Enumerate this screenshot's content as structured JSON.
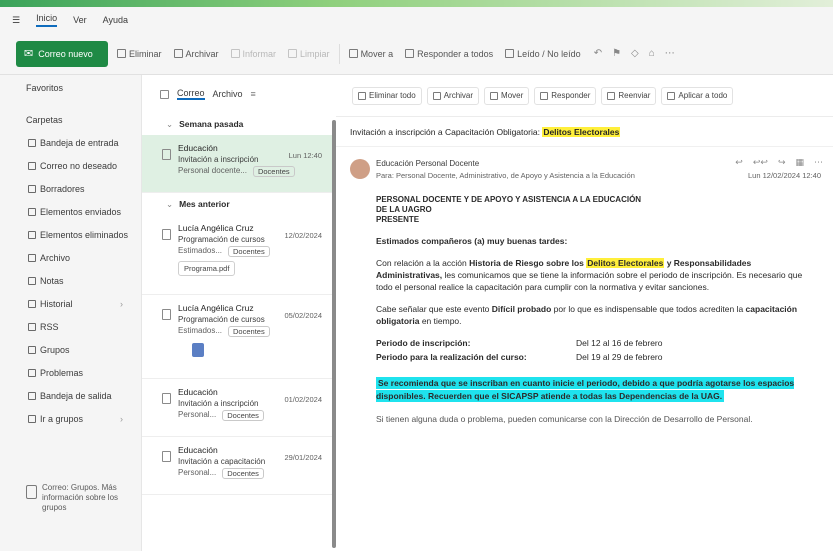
{
  "menubar": {
    "items": [
      "Inicio",
      "Ver",
      "Ayuda"
    ]
  },
  "ribbon": {
    "new_mail": "Correo nuevo",
    "buttons": [
      "Eliminar",
      "Archivar",
      "Informar",
      "Limpiar",
      "Mover a",
      "Responder a todos",
      "Leído / No leído"
    ],
    "dim_buttons": [
      2,
      3
    ]
  },
  "sidebar": {
    "favorites": "Favoritos",
    "folders_header": "Carpetas",
    "folders": [
      {
        "label": "Bandeja de entrada",
        "chevron": false
      },
      {
        "label": "Correo no deseado",
        "chevron": false
      },
      {
        "label": "Borradores",
        "chevron": false
      },
      {
        "label": "Elementos enviados",
        "chevron": false
      },
      {
        "label": "Elementos eliminados",
        "chevron": false
      },
      {
        "label": "Archivo",
        "chevron": false
      },
      {
        "label": "Notas",
        "chevron": false
      },
      {
        "label": "Historial",
        "chevron": true
      },
      {
        "label": "RSS",
        "chevron": false
      },
      {
        "label": "Grupos",
        "chevron": false
      },
      {
        "label": "Problemas",
        "chevron": false
      },
      {
        "label": "Bandeja de salida",
        "chevron": false
      },
      {
        "label": "Ir a grupos",
        "chevron": true
      }
    ],
    "group_note": "Correo: Grupos. Más información sobre los grupos"
  },
  "list": {
    "tabs": [
      "Correo",
      "Archivo"
    ],
    "groups": [
      {
        "label": "Semana pasada",
        "messages": [
          {
            "from": "Educación",
            "subject": "Invitación a inscripción",
            "preview": "Personal docente...",
            "time": "Lun 12:40",
            "tag": "Docentes",
            "selected": true,
            "attachment": "",
            "doc": false
          }
        ]
      },
      {
        "label": "Mes anterior",
        "messages": [
          {
            "from": "Lucía Angélica Cruz",
            "subject": "Programación de cursos",
            "preview": "Estimados...",
            "time": "12/02/2024",
            "tag": "Docentes",
            "selected": false,
            "attachment": "Programa.pdf",
            "doc": false
          },
          {
            "from": "Lucía Angélica Cruz",
            "subject": "Programación de cursos",
            "preview": "Estimados...",
            "time": "05/02/2024",
            "tag": "Docentes",
            "selected": false,
            "attachment": "",
            "doc": true
          },
          {
            "from": "Educación",
            "subject": "Invitación a inscripción",
            "preview": "Personal...",
            "time": "01/02/2024",
            "tag": "Docentes",
            "selected": false,
            "attachment": "",
            "doc": false
          },
          {
            "from": "Educación",
            "subject": "Invitación a capacitación",
            "preview": "Personal...",
            "time": "29/01/2024",
            "tag": "Docentes",
            "selected": false,
            "attachment": "",
            "doc": false
          }
        ]
      }
    ]
  },
  "reading": {
    "toolbar": [
      "Eliminar todo",
      "Archivar",
      "Mover",
      "Responder",
      "Reenviar",
      "Aplicar a todo"
    ],
    "subject_prefix": "Invitación a inscripción a Capacitación Obligatoria:",
    "subject_highlight": "Delitos Electorales",
    "sender_name": "Educación Personal Docente",
    "sender_to": "Para: Personal Docente, Administrativo, de Apoyo y Asistencia a la Educación",
    "date": "Lun 12/02/2024 12:40",
    "addressee": [
      "PERSONAL DOCENTE Y DE APOYO Y ASISTENCIA A LA EDUCACIÓN",
      "DE LA UAGRO",
      "PRESENTE"
    ],
    "greeting": "Estimados compañeros (a) muy buenas tardes:",
    "para1_a": "Con relación a la acción",
    "para1_b": "Historia de Riesgo sobre los",
    "para1_c": "Delitos Electorales",
    "para1_d": "y Responsabilidades Administrativas,",
    "para1_rest": "les comunicamos que se tiene la información sobre el periodo de inscripción. Es necesario que todo el personal realice la capacitación para cumplir con la normativa y evitar sanciones.",
    "para2_a": "Cabe señalar que este evento",
    "para2_b": "Difícil probado",
    "para2_c": "por lo que es indispensable que todos acrediten la",
    "para2_d": "capacitación obligatoria",
    "para2_e": "en tiempo.",
    "periods": [
      {
        "label": "Periodo de inscripción:",
        "value": "Del 12 al 16 de febrero"
      },
      {
        "label": "Periodo para la realización del curso:",
        "value": "Del 19 al 29 de febrero"
      }
    ],
    "cyan_note": "Se recomienda que se inscriban en cuanto inicie el periodo, debido a que podría agotarse los espacios disponibles. Recuerden que el SICAPSP atiende a todas las Dependencias de la UAG.",
    "footer": "Si tienen alguna duda o problema, pueden comunicarse con la Dirección de Desarrollo de Personal."
  }
}
